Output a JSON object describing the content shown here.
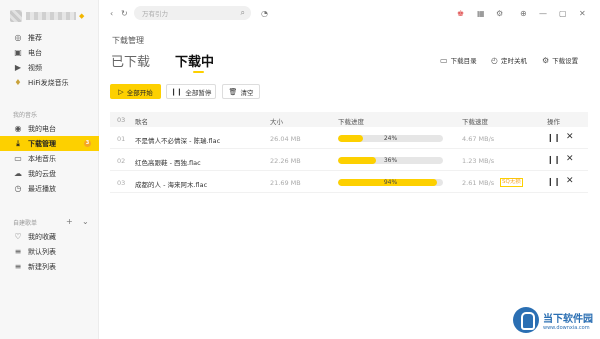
{
  "sidebar": {
    "items_top": [
      {
        "label": "推荐",
        "icon": "recommend-icon"
      },
      {
        "label": "电台",
        "icon": "radio-icon"
      },
      {
        "label": "视频",
        "icon": "video-icon"
      },
      {
        "label": "HiFi发烧音乐",
        "icon": "hifi-icon"
      }
    ],
    "section_my_music": "我的音乐",
    "items_my": [
      {
        "label": "我的电台",
        "icon": "my-radio-icon"
      },
      {
        "label": "下载管理",
        "icon": "download-icon",
        "badge": "3"
      },
      {
        "label": "本地音乐",
        "icon": "local-music-icon"
      },
      {
        "label": "我的云盘",
        "icon": "cloud-icon"
      },
      {
        "label": "最近播放",
        "icon": "history-icon"
      }
    ],
    "section_playlists": "自建歌单",
    "items_playlists": [
      {
        "label": "我的收藏",
        "icon": "heart-icon"
      },
      {
        "label": "默认列表",
        "icon": "list-icon"
      },
      {
        "label": "新建列表",
        "icon": "list-icon"
      }
    ]
  },
  "search": {
    "placeholder": "万有引力"
  },
  "main": {
    "page_title": "下载管理",
    "tab_done": "已下载",
    "tab_active": "下载中",
    "links": {
      "dir": "下载目录",
      "timer": "定时关机",
      "settings": "下载设置"
    },
    "buttons": {
      "start_all": "全部开始",
      "pause_all": "全部暂停",
      "clear": "清空"
    },
    "table": {
      "count": "03",
      "headers": {
        "name": "歌名",
        "size": "大小",
        "progress": "下载进度",
        "speed": "下载速度",
        "ops": "操作"
      },
      "rows": [
        {
          "idx": "01",
          "title": "不是情人不必情深 - 陈瑞.flac",
          "size": "26.04 MB",
          "progress": 24,
          "progress_label": "24%",
          "speed": "4.67 MB/s",
          "tag": ""
        },
        {
          "idx": "02",
          "title": "红色高跟鞋 - 西独.flac",
          "size": "22.26 MB",
          "progress": 36,
          "progress_label": "36%",
          "speed": "1.23 MB/s",
          "tag": ""
        },
        {
          "idx": "03",
          "title": "成都的人 - 海来阿木.flac",
          "size": "21.69 MB",
          "progress": 94,
          "progress_label": "94%",
          "speed": "2.61 MB/s",
          "tag": "SQ无损"
        }
      ]
    }
  },
  "watermark": {
    "cn": "当下软件园",
    "url": "www.downxia.com"
  },
  "colors": {
    "accent": "#fdd000",
    "sidebar_bg": "#f7f7f7"
  }
}
